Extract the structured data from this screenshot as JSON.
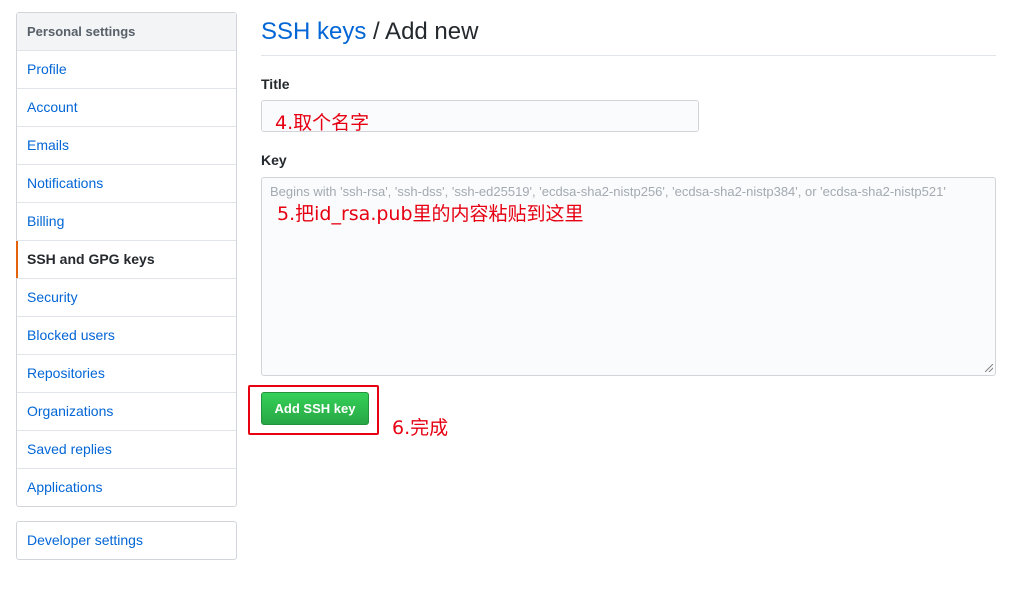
{
  "sidebar": {
    "heading": "Personal settings",
    "items": [
      {
        "label": "Profile"
      },
      {
        "label": "Account"
      },
      {
        "label": "Emails"
      },
      {
        "label": "Notifications"
      },
      {
        "label": "Billing"
      },
      {
        "label": "SSH and GPG keys",
        "selected": true
      },
      {
        "label": "Security"
      },
      {
        "label": "Blocked users"
      },
      {
        "label": "Repositories"
      },
      {
        "label": "Organizations"
      },
      {
        "label": "Saved replies"
      },
      {
        "label": "Applications"
      }
    ],
    "developer_settings": "Developer settings"
  },
  "header": {
    "breadcrumb_link": "SSH keys",
    "breadcrumb_rest": " / Add new"
  },
  "form": {
    "title_label": "Title",
    "title_value": "",
    "key_label": "Key",
    "key_placeholder": "Begins with 'ssh-rsa', 'ssh-dss', 'ssh-ed25519', 'ecdsa-sha2-nistp256', 'ecdsa-sha2-nistp384', or 'ecdsa-sha2-nistp521'",
    "submit_label": "Add SSH key"
  },
  "annotations": {
    "step4": "4.取个名字",
    "step5": "5.把id_rsa.pub里的内容粘贴到这里",
    "step6": "6.完成"
  },
  "colors": {
    "link": "#0366d6",
    "selected_marker": "#e36209",
    "primary_button": "#28a745",
    "annotation": "#e60012"
  }
}
